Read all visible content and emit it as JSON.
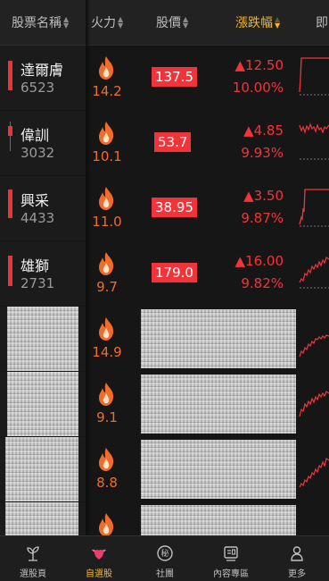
{
  "header": {
    "columns": [
      {
        "label": "股票名稱",
        "active": false
      },
      {
        "label": "火力",
        "active": false
      },
      {
        "label": "股價",
        "active": false
      },
      {
        "label": "漲跌幅",
        "active": true
      },
      {
        "label": "即"
      }
    ]
  },
  "rows": [
    {
      "name": "達爾膚",
      "code": "6523",
      "heat": "14.2",
      "price": "137.5",
      "change": "▲12.50",
      "pct": "10.00%",
      "redacted": false
    },
    {
      "name": "偉訓",
      "code": "3032",
      "heat": "10.1",
      "price": "53.7",
      "change": "▲4.85",
      "pct": "9.93%",
      "redacted": false
    },
    {
      "name": "興采",
      "code": "4433",
      "heat": "11.0",
      "price": "38.95",
      "change": "▲3.50",
      "pct": "9.87%",
      "redacted": false
    },
    {
      "name": "雄獅",
      "code": "2731",
      "heat": "9.7",
      "price": "179.0",
      "change": "▲16.00",
      "pct": "9.82%",
      "redacted": false
    },
    {
      "heat": "14.9",
      "redacted": true
    },
    {
      "heat": "9.1",
      "redacted": true
    },
    {
      "heat": "8.8",
      "redacted": true
    }
  ],
  "nav": [
    {
      "label": "選股頁",
      "icon": "seedling-icon",
      "active": false
    },
    {
      "label": "自選股",
      "icon": "winged-heart-icon",
      "active": true
    },
    {
      "label": "社團",
      "icon": "secret-badge-icon",
      "active": false,
      "glyph": "秘"
    },
    {
      "label": "內容專區",
      "icon": "content-icon",
      "active": false
    },
    {
      "label": "更多",
      "icon": "person-icon",
      "active": false
    }
  ],
  "colors": {
    "up": "#f0343a",
    "accent": "#f5b531",
    "heat": "#f06c2c"
  }
}
